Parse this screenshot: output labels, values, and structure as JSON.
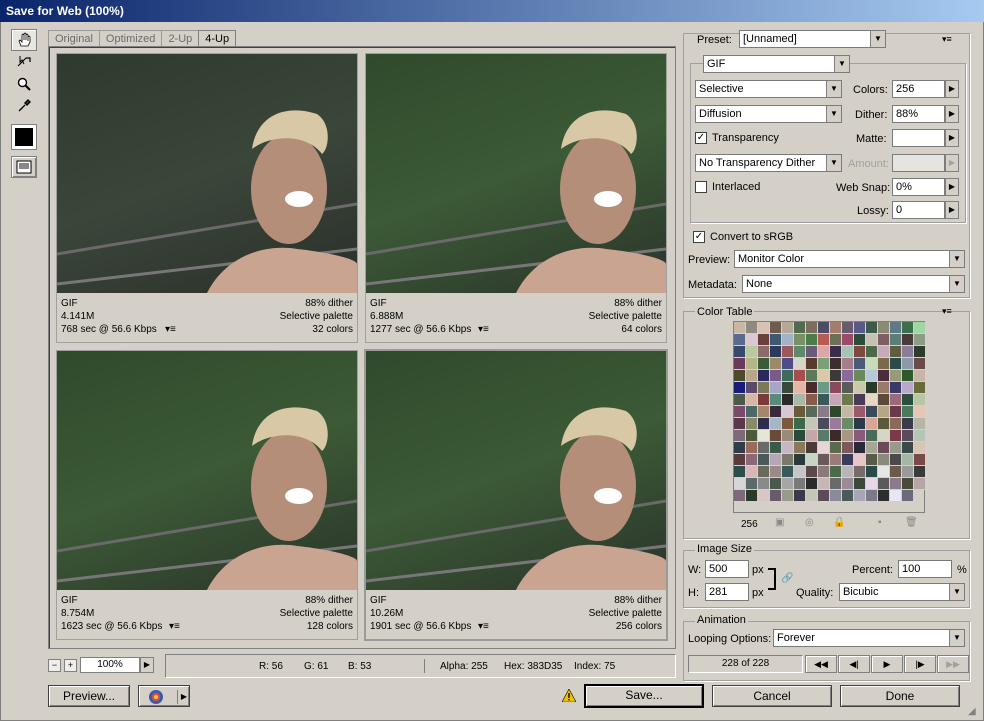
{
  "window": {
    "title": "Save for Web (100%)"
  },
  "tools": [
    {
      "name": "hand-tool",
      "icon": "hand-icon"
    },
    {
      "name": "slice-select-tool",
      "icon": "slice-select-icon"
    },
    {
      "name": "zoom-tool",
      "icon": "magnifier-icon"
    },
    {
      "name": "eyedropper-tool",
      "icon": "eyedropper-icon"
    }
  ],
  "tabs": [
    {
      "label": "Original"
    },
    {
      "label": "Optimized"
    },
    {
      "label": "2-Up"
    },
    {
      "label": "4-Up",
      "active": true
    }
  ],
  "previews": [
    {
      "format": "GIF",
      "size": "4.141M",
      "time": "768 sec @ 56.6 Kbps",
      "dither": "88% dither",
      "palette": "Selective palette",
      "colors": "32 colors"
    },
    {
      "format": "GIF",
      "size": "6.888M",
      "time": "1277 sec @ 56.6 Kbps",
      "dither": "88% dither",
      "palette": "Selective palette",
      "colors": "64 colors"
    },
    {
      "format": "GIF",
      "size": "8.754M",
      "time": "1623 sec @ 56.6 Kbps",
      "dither": "88% dither",
      "palette": "Selective palette",
      "colors": "128 colors"
    },
    {
      "format": "GIF",
      "size": "10.26M",
      "time": "1901 sec @ 56.6 Kbps",
      "dither": "88% dither",
      "palette": "Selective palette",
      "colors": "256 colors"
    }
  ],
  "zoom": {
    "minus": "−",
    "plus": "+",
    "value": "100%"
  },
  "status": {
    "r": "R: 56",
    "g": "G: 61",
    "b": "B: 53",
    "alpha": "Alpha: 255",
    "hex": "Hex: 383D35",
    "index": "Index: 75"
  },
  "buttons": {
    "preview": "Preview...",
    "save": "Save...",
    "cancel": "Cancel",
    "done": "Done"
  },
  "settings": {
    "preset_label": "Preset:",
    "preset_value": "[Unnamed]",
    "format": "GIF",
    "reduction": "Selective",
    "dither_algo": "Diffusion",
    "transparency_label": "Transparency",
    "transparency_checked": true,
    "transparency_dither": "No Transparency Dither",
    "interlaced_label": "Interlaced",
    "interlaced_checked": false,
    "colors_label": "Colors:",
    "colors_value": "256",
    "dither_label": "Dither:",
    "dither_value": "88%",
    "matte_label": "Matte:",
    "amount_label": "Amount:",
    "websnap_label": "Web Snap:",
    "websnap_value": "0%",
    "lossy_label": "Lossy:",
    "lossy_value": "0",
    "convert_label": "Convert to sRGB",
    "convert_checked": true,
    "preview_label": "Preview:",
    "preview_value": "Monitor Color",
    "metadata_label": "Metadata:",
    "metadata_value": "None"
  },
  "color_table": {
    "title": "Color Table",
    "count": "256",
    "colors": [
      "#c9b7a4",
      "#8e8a82",
      "#d7c1b4",
      "#6f5a4e",
      "#b4a999",
      "#526b4e",
      "#7d6d5f",
      "#4b4d67",
      "#a47d6c",
      "#685b6d",
      "#5a5a88",
      "#3e5b4a",
      "#8a8b72",
      "#5f7a87",
      "#3d6f49",
      "#9fd6a1",
      "#5a6a8e",
      "#dcc8d0",
      "#6b3f3b",
      "#3d5a70",
      "#a2b3c7",
      "#7a8f65",
      "#4a7d49",
      "#b85b54",
      "#6e6f59",
      "#9c4a6a",
      "#2d4a3a",
      "#c6c1b1",
      "#7c5e63",
      "#5d7d7a",
      "#4a3a3a",
      "#8d9d85",
      "#384a6b",
      "#b9c89f",
      "#8a6d6a",
      "#2c3a5a",
      "#9a5a5a",
      "#5c8a6a",
      "#6a5a7c",
      "#dca6a6",
      "#3a2c4a",
      "#a6c2b5",
      "#7d4a3d",
      "#4a6a4a",
      "#c8a9b9",
      "#5e5d3d",
      "#8a7d9a",
      "#2d3d2d",
      "#6a3a5a",
      "#b5b58a",
      "#3a5a3a",
      "#9a8a6a",
      "#4d4d8a",
      "#d5d5c8",
      "#5a3a2c",
      "#7aa07a",
      "#3d2d2d",
      "#a67d8a",
      "#4a5a7a",
      "#c9d9b9",
      "#7a6a4a",
      "#2c4a4a",
      "#8a9aa6",
      "#6a4a4a",
      "#4a4a2c",
      "#b8a68a",
      "#2a2a5a",
      "#7a5a8a",
      "#3d6a5a",
      "#a64d4d",
      "#5a7a5a",
      "#d9c9a6",
      "#3a3a3a",
      "#8a6a9a",
      "#6a8a5a",
      "#b5c9d9",
      "#4d2d3d",
      "#9a9a7a",
      "#2d5a2d",
      "#c7b5a6",
      "#1a1a7a",
      "#5a4a6a",
      "#7a7a5a",
      "#a6a6c8",
      "#3a4a3a",
      "#e5b5a5",
      "#4a2a2a",
      "#6a9a8a",
      "#8a4a5a",
      "#5a5a5a",
      "#c9c9a9",
      "#2a3a2a",
      "#9a7a6a",
      "#3a3a6a",
      "#b9a9c9",
      "#6a6a3a",
      "#4a5a4a",
      "#d6b6a6",
      "#7a3a3a",
      "#5a8a7a",
      "#2a2a2a",
      "#a9b9a9",
      "#8a5a4a",
      "#3a5a5a",
      "#c6a6b6",
      "#6a7a4a",
      "#4a3a5a",
      "#e6d6c6",
      "#5a4a3a",
      "#9a6a7a",
      "#2d4d3d",
      "#b6c6a6",
      "#7a4a6a",
      "#4a6a6a",
      "#a6866a",
      "#3a2a3a",
      "#d6c6d6",
      "#6a5a3a",
      "#5a6a5a",
      "#8a7a8a",
      "#2a4a2a",
      "#c6b6a6",
      "#9a5a6a",
      "#3a4a5a",
      "#b6a686",
      "#6a3a4a",
      "#4a7a5a",
      "#e6c6b6",
      "#5a3a4a",
      "#8a8a6a",
      "#2d2d4d",
      "#a6b6c6",
      "#7a5a3a",
      "#3a6a4a",
      "#c6c6b6",
      "#4a4a5a",
      "#9a7a9a",
      "#6a8a6a",
      "#2a3a4a",
      "#d6a696",
      "#5a5a3a",
      "#8a6a5a",
      "#3a3a4a",
      "#b6b6a6",
      "#7a6a7a",
      "#4a5a3a",
      "#e6e6d6",
      "#6a4a3a",
      "#9a8a7a",
      "#2a4a3a",
      "#c6a6a6",
      "#5a7a6a",
      "#3a2a2a",
      "#a69686",
      "#8a5a7a",
      "#4a6a5a",
      "#d6d6c6",
      "#7a3a4a",
      "#5a4a5a",
      "#b6c6b6",
      "#2d3d4d",
      "#9a6a5a",
      "#6a6a6a",
      "#3a5a4a",
      "#c6b6c6",
      "#8a7a5a",
      "#4a3a3a",
      "#e6d6d6",
      "#5a6a4a",
      "#7a5a5a",
      "#2a2a3a",
      "#a6a696",
      "#6a4a5a",
      "#9a9a8a",
      "#3a4a4a",
      "#d6c6b6",
      "#5a3a3a",
      "#8a6a7a",
      "#4a5a5a",
      "#b6a6b6",
      "#7a7a6a",
      "#2a3a3a",
      "#c6d6c6",
      "#6a5a5a",
      "#9a7a7a",
      "#3a3a5a",
      "#e6c6c6",
      "#5a5a4a",
      "#8a8a7a",
      "#4a4a4a",
      "#a6b6a6",
      "#7a4a4a",
      "#2d4d4d",
      "#d6b6b6",
      "#6a6a5a",
      "#9a8a8a",
      "#3a5a5a",
      "#c6c6c6",
      "#5a4a4a",
      "#8a7a7a",
      "#4a6a4a",
      "#b6b6b6",
      "#7a6a6a",
      "#2a4a4a",
      "#e6e6e6",
      "#6a5a4a",
      "#9a9a9a",
      "#3a3a3a",
      "#d6d6d6",
      "#5a6a6a",
      "#8a8a8a",
      "#4a5a4a",
      "#a6a6a6",
      "#7a7a7a",
      "#2a2a2a",
      "#c6b6b6",
      "#6a6a6a",
      "#9a8a9a",
      "#3a4a3a",
      "#e6d6e6",
      "#5a5a5a",
      "#8a7a8a",
      "#4a4a3a",
      "#b6a6a6",
      "#7a6a7a",
      "#2a3a2a",
      "#d6c6c6",
      "#6a5a6a",
      "#9a9a8a",
      "#3a3a4a",
      "#c6c6b6",
      "#5a4a5a",
      "#8a8a9a",
      "#4a5a5a",
      "#a6a6b6",
      "#7a7a8a",
      "#2d2d2d",
      "#e6e6f6",
      "#6a6a7a"
    ]
  },
  "image_size": {
    "title": "Image Size",
    "w_label": "W:",
    "w_value": "500",
    "w_unit": "px",
    "h_label": "H:",
    "h_value": "281",
    "h_unit": "px",
    "percent_label": "Percent:",
    "percent_value": "100",
    "percent_unit": "%",
    "quality_label": "Quality:",
    "quality_value": "Bicubic"
  },
  "animation": {
    "title": "Animation",
    "looping_label": "Looping Options:",
    "looping_value": "Forever",
    "frame_count": "228 of 228"
  }
}
